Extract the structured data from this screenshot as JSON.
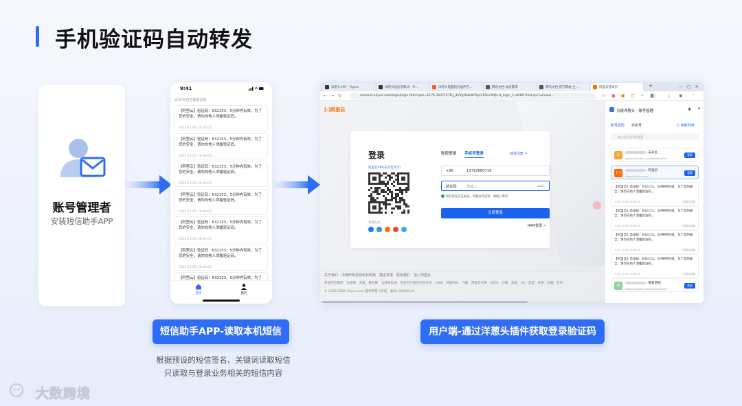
{
  "title": "手机验证码自动转发",
  "admin": {
    "name": "账号管理者",
    "subtitle": "安装短信助手APP"
  },
  "phone": {
    "time": "9:41",
    "header": "近30天短信接收记录",
    "messages": [
      {
        "text": "【阿里云】验证码：632153，5分钟内有效。为了您的安全，请勿向他人泄露验证码。",
        "time": "2025-11-05 16:00:00"
      },
      {
        "text": "【阿里云】验证码：632153，5分钟内有效。为了您的安全，请勿向他人泄露验证码。",
        "time": "2025-11-05 16:00:00"
      },
      {
        "text": "【阿里云】验证码：632153，5分钟内有效。为了您的安全，请勿向他人泄露验证码。",
        "time": "2025-11-05 16:00:00"
      },
      {
        "text": "【阿里云】验证码：632153，5分钟内有效。为了您的安全，请勿向他人泄露验证码。",
        "time": "2025-11-05 16:00:00"
      },
      {
        "text": "【阿里云】验证码：632153，5分钟内有效。为了您的安全，请勿向他人泄露验证码。",
        "time": "2025-11-05 16:00:00"
      },
      {
        "text": "【阿里云】验证码：632153，5分钟内有效。为了您的安全，请勿向他人泄露验证码。",
        "time": "2025-11-05 16:00:00"
      },
      {
        "text": "【阿里云】验证码：632153，5分钟内有效。为了您的安全，请勿向他人泄露验证码。",
        "time": "2025-11-05 16:00:00"
      }
    ],
    "tabs": {
      "home": "首页",
      "mine": "我的"
    }
  },
  "browser": {
    "tabs": [
      {
        "label": "洋葱头APP - Figma",
        "color": "#333333"
      },
      {
        "label": "洋葱头短信项目UI - Fi...",
        "color": "#333333"
      },
      {
        "label": "洋葱头电脑机包插件方...",
        "color": "#f25c2a"
      },
      {
        "label": "腾讯文档-动态需求",
        "color": "#555555"
      },
      {
        "label": "腾讯文档-官方网站-主...",
        "color": "#555555"
      },
      {
        "label": "阿里云登录页",
        "color": "#ff6a00"
      }
    ],
    "url": "account.aliyun.com/login/login.htm?spm=5176.30371578.J_4VYgf18xNlTAyFFbOuO0Qe.d_login_1.e939154aLcpCIv&oaut...",
    "logo": "[-]阿里云",
    "login": {
      "title": "登录",
      "qr_hint": "阿里云APP/支付宝/钉钉",
      "other_label": "其他方式",
      "tab_account": "账密登录",
      "tab_phone": "手机号登录",
      "register_link": "前往注册 >",
      "country_code": "+86",
      "phone_number": "13710680719",
      "code_label": "验证码",
      "code_placeholder": "请输入",
      "countdown": "44秒",
      "sent_notice": "短信验证码已发送，可能会有延迟，请耐心等待",
      "submit": "立即登录",
      "ram_link": "RAM登录 >"
    },
    "footer": {
      "links": "关于我们　法律声明及隐私权政策　廉正举报　联系我们　加入阿里云",
      "sites": "阿里巴巴集团　淘宝网　天猫　聚划算　全球速卖通　阿里巴巴国际交易市场　1688　阿里妈妈　飞猪　阿里云计算　AliOS　万网　高德　UC　友盟　虾米　优酷　钉钉",
      "copyright": "© 2009-2025 Aliyun.com 版权所有 ICP证：浙B2-20080101"
    }
  },
  "sidepanel": {
    "title": "贝锐洋葱头 - 账号管理",
    "tab_account": "账号密码",
    "tab_phone": "手机号",
    "refresh": "刷新列表",
    "search_placeholder": "输入账号名/网站搜索",
    "accounts": [
      {
        "icon": "1",
        "name": "·未命名",
        "url": "https://fuzetan.com/boards/909...",
        "btn": "登录",
        "color": "#f2a93b"
      },
      {
        "icon": "[-]",
        "name": "-阿里云",
        "url": "https://aliyun.com",
        "btn": "登录",
        "color": "#ff6a00"
      },
      {
        "icon": "M",
        "name": "·网易游戏",
        "url": "https://fuzetan.com/boards/909...",
        "btn": "登录",
        "color": "#8fd39a"
      }
    ],
    "messages": [
      {
        "text": "【阿里云】验证码：632153，5分钟内有效。为了您的安全，请勿向他人泄露验证码。",
        "time": "2025-11-05 16:00:00",
        "tag": "阿里云短信"
      },
      {
        "text": "【阿里云】验证码：632153，5分钟内有效。为了您的安全，请勿向他人泄露验证码。",
        "time": "2025-11-05 16:00:00",
        "tag": "阿里云短信"
      },
      {
        "text": "【阿里云】验证码：632153，5分钟内有效。为了您的安全，请勿向他人泄露验证码。",
        "time": "2025-11-05 16:00:00",
        "tag": "阿里云短信"
      },
      {
        "text": "【阿里云】验证码：632153，5分钟内有效。为了您的安全，请勿向他人泄露验证码。",
        "time": "2025-11-05 16:00:00",
        "tag": "阿里云短信"
      }
    ]
  },
  "labels": {
    "app_pill": "短信助手APP-读取本机短信",
    "user_pill": "用户端-通过洋葱头插件获取登录验证码",
    "desc_line1": "根据预设的短信签名、关键词读取短信",
    "desc_line2": "只读取与登录业务相关的短信内容"
  },
  "brand": {
    "name": "大数跨境"
  },
  "colors": {
    "accent": "#2f6df6",
    "link": "#1a63f0",
    "aliyun": "#ff6a00"
  }
}
